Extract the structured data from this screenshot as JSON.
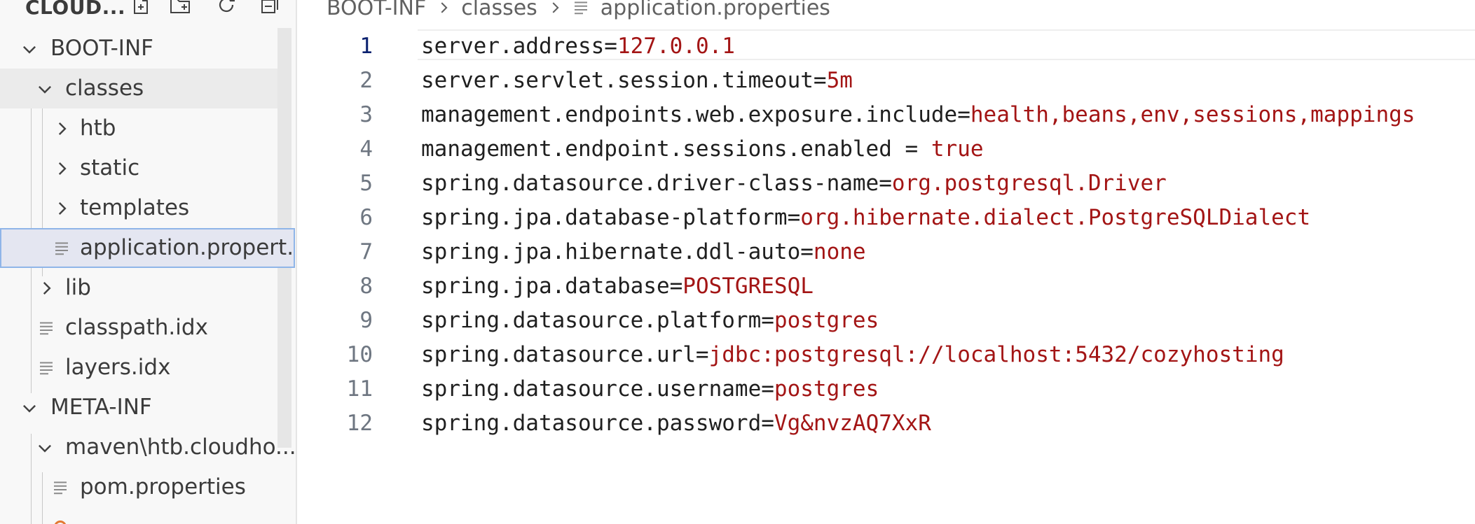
{
  "explorer": {
    "title": "CLOUD...",
    "actions": [
      {
        "name": "new-file-icon"
      },
      {
        "name": "new-folder-icon"
      },
      {
        "name": "refresh-icon"
      },
      {
        "name": "collapse-all-icon"
      }
    ]
  },
  "tree": [
    {
      "label": "BOOT-INF",
      "kind": "folder",
      "expanded": true,
      "depth": 1
    },
    {
      "label": "classes",
      "kind": "folder",
      "expanded": true,
      "depth": 2
    },
    {
      "label": "htb",
      "kind": "folder",
      "expanded": false,
      "depth": 3
    },
    {
      "label": "static",
      "kind": "folder",
      "expanded": false,
      "depth": 3
    },
    {
      "label": "templates",
      "kind": "folder",
      "expanded": false,
      "depth": 3
    },
    {
      "label": "application.propert...",
      "kind": "file",
      "depth": 3
    },
    {
      "label": "lib",
      "kind": "folder",
      "expanded": false,
      "depth": 2
    },
    {
      "label": "classpath.idx",
      "kind": "file",
      "depth": 2
    },
    {
      "label": "layers.idx",
      "kind": "file",
      "depth": 2
    },
    {
      "label": "META-INF",
      "kind": "folder",
      "expanded": true,
      "depth": 1
    },
    {
      "label": "maven\\htb.cloudho...",
      "kind": "folder",
      "expanded": true,
      "depth": 2
    },
    {
      "label": "pom.properties",
      "kind": "file",
      "depth": 3
    }
  ],
  "breadcrumb": {
    "items": [
      "BOOT-INF",
      "classes",
      "application.properties"
    ]
  },
  "editor": {
    "current_line": 1,
    "lines": [
      {
        "no": "1",
        "key": "server.address=",
        "value": "127.0.0.1"
      },
      {
        "no": "2",
        "key": "server.servlet.session.timeout=",
        "value": "5m"
      },
      {
        "no": "3",
        "key": "management.endpoints.web.exposure.include=",
        "value": "health,beans,env,sessions,mappings"
      },
      {
        "no": "4",
        "key": "management.endpoint.sessions.enabled = ",
        "value": "true"
      },
      {
        "no": "5",
        "key": "spring.datasource.driver-class-name=",
        "value": "org.postgresql.Driver"
      },
      {
        "no": "6",
        "key": "spring.jpa.database-platform=",
        "value": "org.hibernate.dialect.PostgreSQLDialect"
      },
      {
        "no": "7",
        "key": "spring.jpa.hibernate.ddl-auto=",
        "value": "none"
      },
      {
        "no": "8",
        "key": "spring.jpa.database=",
        "value": "POSTGRESQL"
      },
      {
        "no": "9",
        "key": "spring.datasource.platform=",
        "value": "postgres"
      },
      {
        "no": "10",
        "key": "spring.datasource.url=",
        "value": "jdbc:postgresql://localhost:5432/cozyhosting"
      },
      {
        "no": "11",
        "key": "spring.datasource.username=",
        "value": "postgres"
      },
      {
        "no": "12",
        "key": "spring.datasource.password=",
        "value": "Vg&nvzAQ7XxR"
      }
    ]
  },
  "colors": {
    "key": "#1f1f1f",
    "value": "#a31515",
    "line_number": "#6e7681",
    "current_line_number": "#0b216f",
    "sidebar_bg": "#f8f8f8",
    "active_file_border": "#8fb5e8"
  }
}
